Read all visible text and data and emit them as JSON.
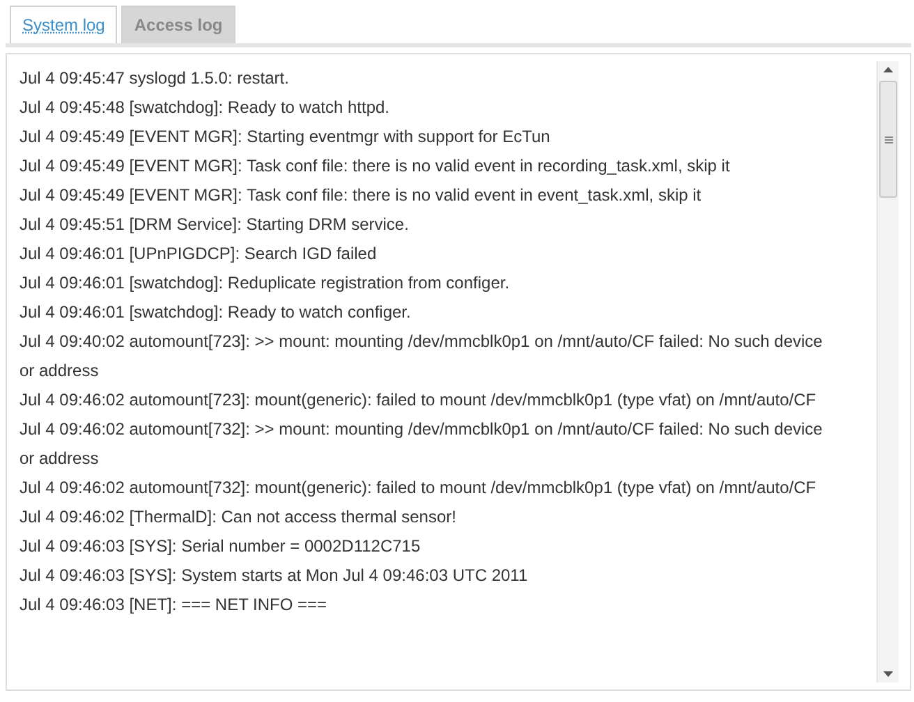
{
  "tabs": [
    {
      "label": "System log",
      "selected": true
    },
    {
      "label": "Access log",
      "selected": false
    }
  ],
  "log": {
    "entries": [
      "Jul 4 09:45:47 syslogd 1.5.0: restart.",
      "Jul 4 09:45:48 [swatchdog]: Ready to watch httpd.",
      "Jul 4 09:45:49 [EVENT MGR]: Starting eventmgr with support for EcTun",
      "Jul 4 09:45:49 [EVENT MGR]: Task conf file: there is no valid event in recording_task.xml, skip it",
      "Jul 4 09:45:49 [EVENT MGR]: Task conf file: there is no valid event in event_task.xml, skip it",
      "Jul 4 09:45:51 [DRM Service]: Starting DRM service.",
      "Jul 4 09:46:01 [UPnPIGDCP]: Search IGD failed",
      "Jul 4 09:46:01 [swatchdog]: Reduplicate registration from configer.",
      "Jul 4 09:46:01 [swatchdog]: Ready to watch configer.",
      "Jul 4 09:40:02 automount[723]: >> mount: mounting /dev/mmcblk0p1 on /mnt/auto/CF failed: No such device or address",
      "Jul 4 09:46:02 automount[723]: mount(generic): failed to mount /dev/mmcblk0p1 (type vfat) on /mnt/auto/CF",
      "Jul 4 09:46:02 automount[732]: >> mount: mounting /dev/mmcblk0p1 on /mnt/auto/CF failed: No such device or address",
      "Jul 4 09:46:02 automount[732]: mount(generic): failed to mount /dev/mmcblk0p1 (type vfat) on /mnt/auto/CF",
      "Jul 4 09:46:02 [ThermalD]: Can not access thermal sensor!",
      "Jul 4 09:46:03 [SYS]: Serial number = 0002D112C715",
      "Jul 4 09:46:03 [SYS]: System starts at Mon Jul 4 09:46:03 UTC 2011",
      "Jul 4 09:46:03 [NET]: === NET INFO ==="
    ]
  }
}
